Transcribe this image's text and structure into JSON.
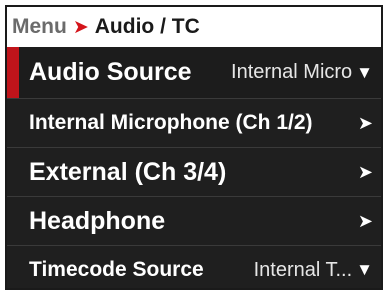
{
  "breadcrumb": {
    "root": "Menu",
    "separator": "➤",
    "current": "Audio / TC"
  },
  "menu": {
    "items": [
      {
        "label": "Audio Source",
        "value": "Internal Micro",
        "indicator": "▼",
        "selected": true
      },
      {
        "label": "Internal Microphone (Ch 1/2)",
        "indicator": "➤"
      },
      {
        "label": "External (Ch 3/4)",
        "indicator": "➤"
      },
      {
        "label": "Headphone",
        "indicator": "➤"
      },
      {
        "label": "Timecode Source",
        "value": "Internal T...",
        "indicator": "▼"
      }
    ]
  },
  "colors": {
    "accent": "#c0141b",
    "menu_background": "#1f1f1f",
    "breadcrumb_root": "#6b6b6b"
  }
}
